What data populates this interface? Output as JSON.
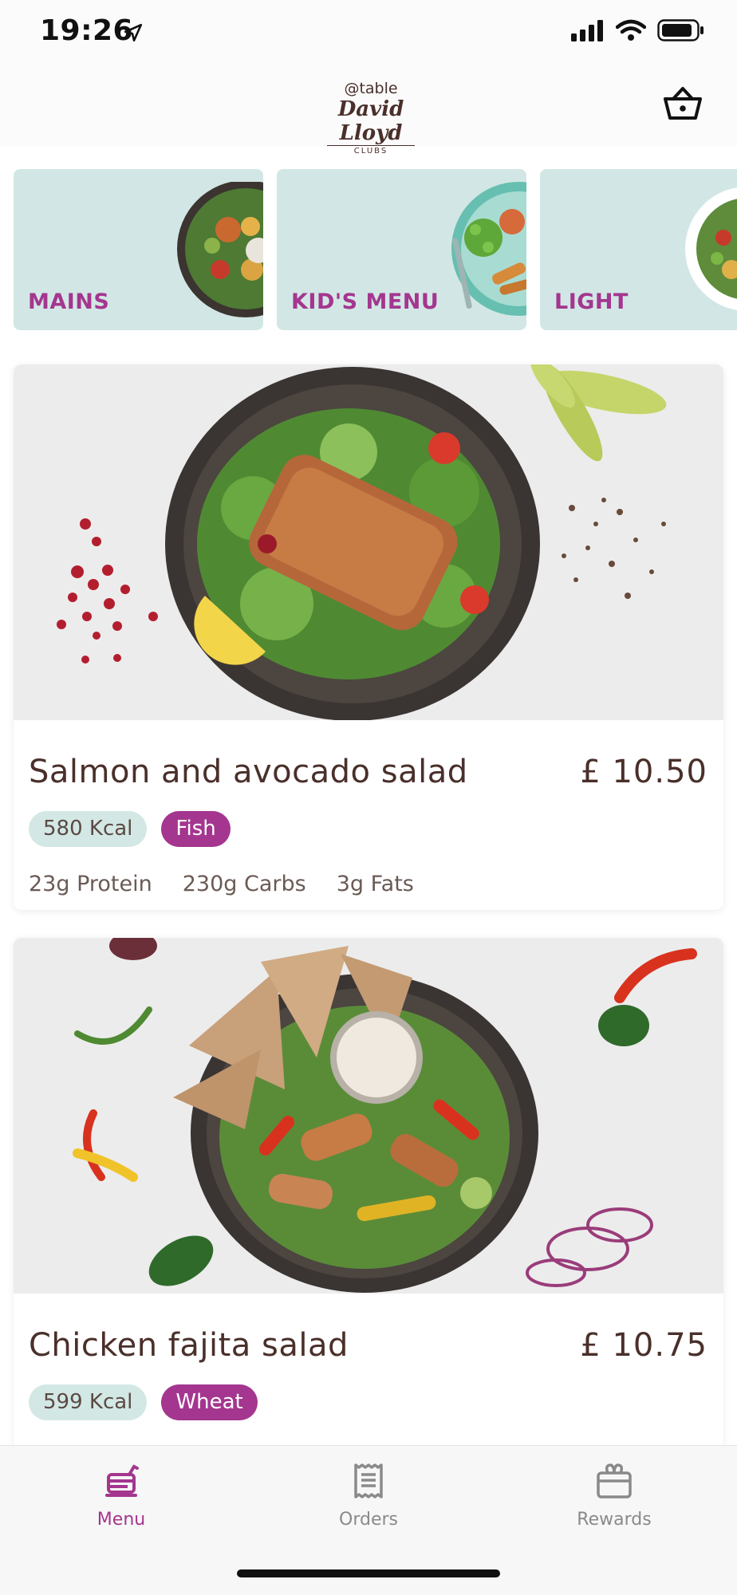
{
  "status_bar": {
    "time": "19:26",
    "icons": [
      "location-arrow-icon",
      "signal-icon",
      "wifi-icon",
      "battery-icon"
    ]
  },
  "header": {
    "logo_at": "@table",
    "logo_brand": "David Lloyd",
    "logo_clubs": "CLUBS",
    "basket_icon": "basket-icon"
  },
  "colors": {
    "accent": "#a4368f",
    "category_bg": "#d2e7e5",
    "kcal_tag_bg": "#d3e8e5",
    "text": "#4a2f2a",
    "inactive": "#8a8a8a"
  },
  "categories": [
    {
      "label": "MAINS"
    },
    {
      "label": "KID'S MENU"
    },
    {
      "label": "LIGHT"
    }
  ],
  "dishes": [
    {
      "name": "Salmon and avocado salad",
      "price": "£ 10.50",
      "kcal": "580 Kcal",
      "allergen": "Fish",
      "protein": "23g Protein",
      "carbs": "230g Carbs",
      "fats": "3g Fats"
    },
    {
      "name": "Chicken fajita salad",
      "price": "£ 10.75",
      "kcal": "599 Kcal",
      "allergen": "Wheat"
    }
  ],
  "tabs": [
    {
      "label": "Menu",
      "icon": "menu-tray-icon",
      "active": true
    },
    {
      "label": "Orders",
      "icon": "receipt-icon",
      "active": false
    },
    {
      "label": "Rewards",
      "icon": "gift-icon",
      "active": false
    }
  ]
}
